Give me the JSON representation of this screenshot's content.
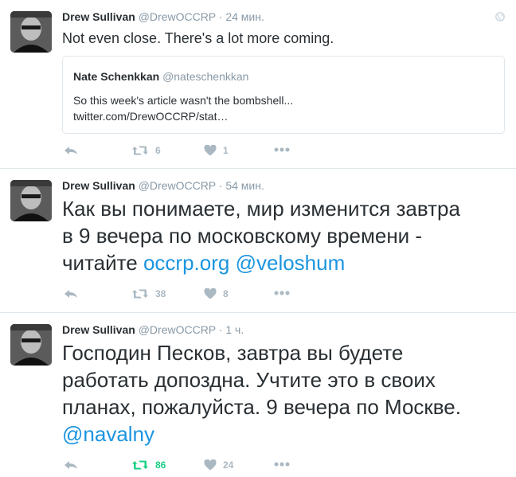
{
  "tweets": [
    {
      "name": "Drew Sullivan",
      "handle": "@DrewOCCRP",
      "dot": "·",
      "time": "24 мин.",
      "text": "Not even close. There's a lot more coming.",
      "quote": {
        "name": "Nate Schenkkan",
        "handle": "@nateschenkkan",
        "line1": "So this week's article wasn't the bombshell...",
        "line2": "twitter.com/DrewOCCRP/stat…"
      },
      "retweets": "6",
      "likes": "1"
    },
    {
      "name": "Drew Sullivan",
      "handle": "@DrewOCCRP",
      "dot": "·",
      "time": "54 мин.",
      "line1": "Как вы понимаете, мир изменится завтра",
      "line2": "в 9 вечера по московскому времени -",
      "line3_prefix": "читайте ",
      "link1": "occrp.org",
      "sep": " ",
      "link2": "@veloshum",
      "retweets": "38",
      "likes": "8"
    },
    {
      "name": "Drew Sullivan",
      "handle": "@DrewOCCRP",
      "dot": "·",
      "time": "1 ч.",
      "line1": "Господин Песков, завтра вы будете",
      "line2": "работать допоздна. Учтите это в своих",
      "line3": "планах, пожалуйста. 9 вечера по Москве.",
      "link": "@navalny",
      "retweets": "86",
      "likes": "24"
    }
  ],
  "colors": {
    "link": "#1b95e0",
    "retweeted": "#19cf86",
    "muted": "#aab8c2"
  },
  "icons": [
    "globe-icon",
    "reply-icon",
    "retweet-icon",
    "like-icon",
    "more-icon"
  ]
}
